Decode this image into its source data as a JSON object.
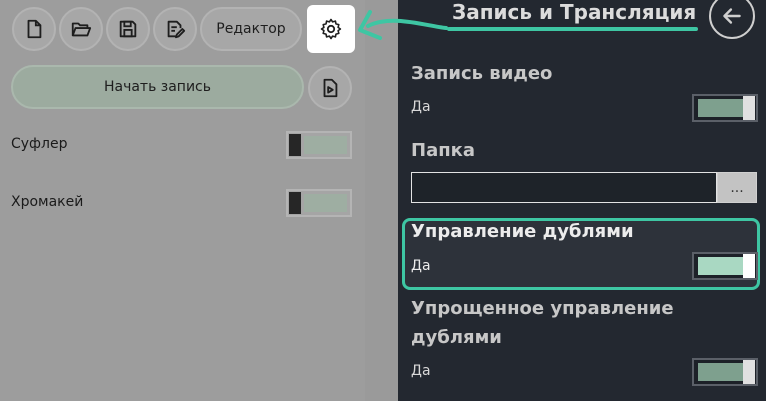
{
  "toolbar": {
    "editor_label": "Редактор",
    "icons": [
      "new-file-icon",
      "open-folder-icon",
      "save-icon",
      "edit-file-icon",
      "gear-icon"
    ]
  },
  "recording": {
    "start_label": "Начать запись",
    "side_icon": "video-file-icon"
  },
  "options": [
    {
      "label": "Суфлер",
      "enabled": false
    },
    {
      "label": "Хромакей",
      "enabled": false
    }
  ],
  "settings": {
    "title": "Запись и Трансляция",
    "sections": {
      "record_video": {
        "title": "Запись видео",
        "value": "Да"
      },
      "folder": {
        "title": "Папка",
        "value": "",
        "browse_label": "..."
      },
      "duplicates": {
        "title": "Управление дублями",
        "value": "Да"
      },
      "simple_duplicates": {
        "title_line1": "Упрощенное управление",
        "title_line2": "дублями",
        "value": "Да"
      }
    }
  },
  "colors": {
    "accent": "#3ec6a3",
    "panel_bg": "#232830",
    "dim_bg": "#9d9d9d"
  }
}
